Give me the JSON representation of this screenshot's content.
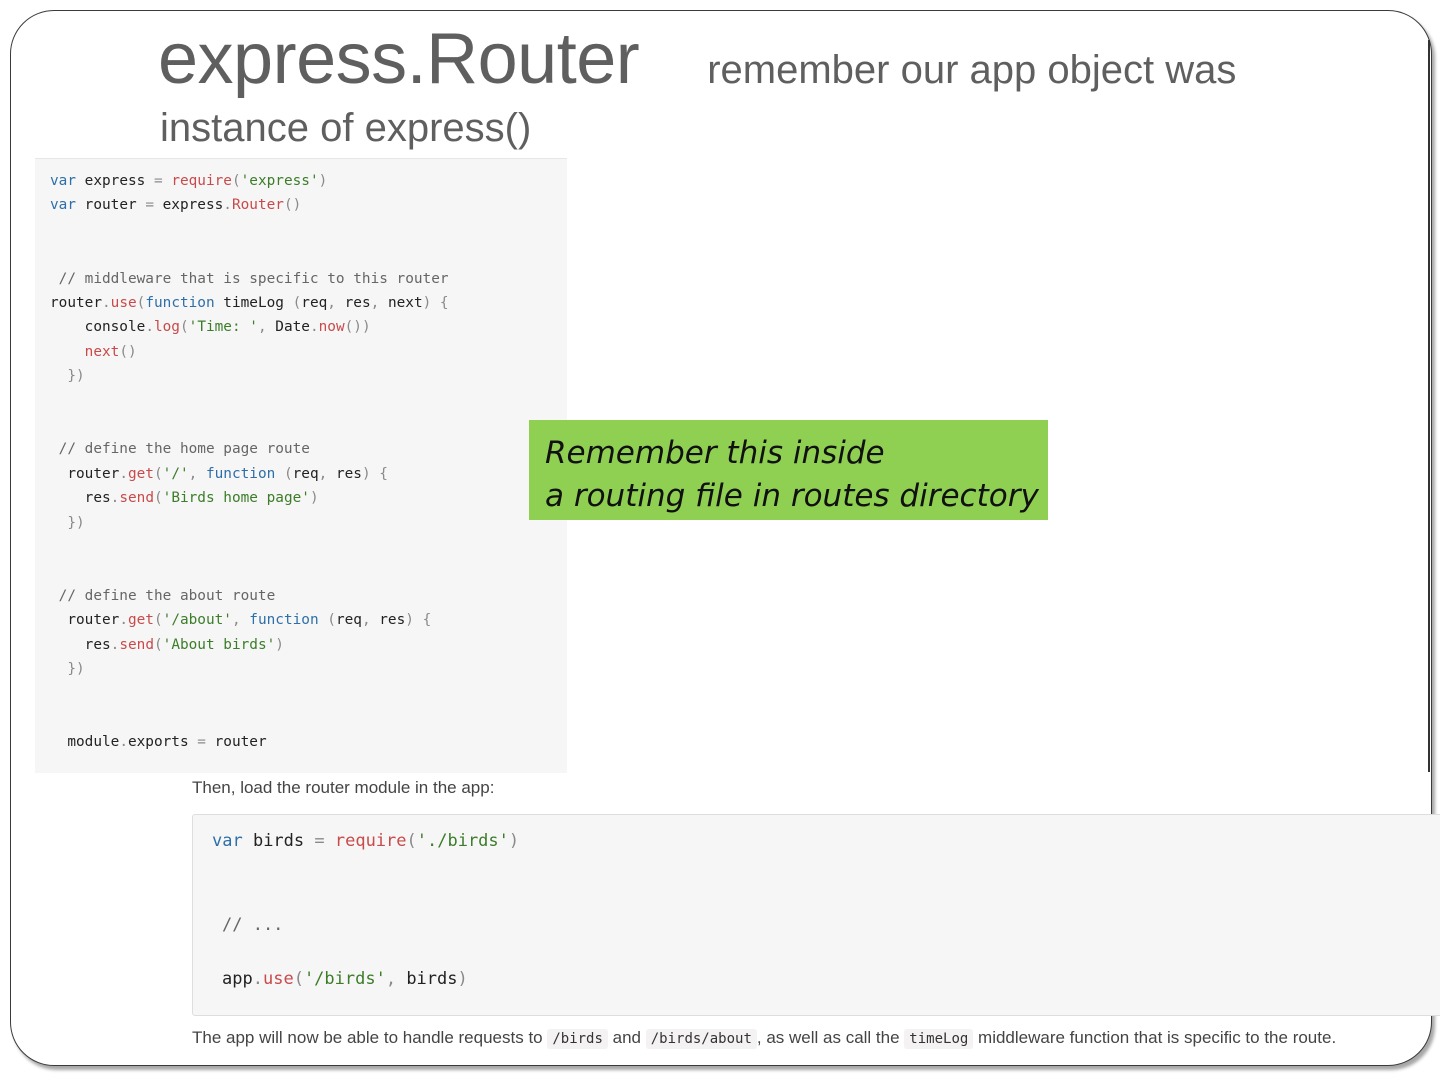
{
  "title": {
    "main": "express.Router",
    "sub": "remember our app object  was",
    "line2": "instance of express()"
  },
  "code_block_1": [
    [
      [
        "kw",
        "var"
      ],
      [
        "idn",
        " express "
      ],
      [
        "punc",
        "= "
      ],
      [
        "fn",
        "require"
      ],
      [
        "punc",
        "("
      ],
      [
        "str",
        "'express'"
      ],
      [
        "punc",
        ")"
      ]
    ],
    [
      [
        "kw",
        "var"
      ],
      [
        "idn",
        " router "
      ],
      [
        "punc",
        "= "
      ],
      [
        "idn",
        "express"
      ],
      [
        "punc",
        "."
      ],
      [
        "fn",
        "Router"
      ],
      [
        "punc",
        "()"
      ]
    ],
    [],
    [],
    [
      [
        "cmt",
        " // middleware that is specific to this router"
      ]
    ],
    [
      [
        "idn",
        "router"
      ],
      [
        "punc",
        "."
      ],
      [
        "fn",
        "use"
      ],
      [
        "punc",
        "("
      ],
      [
        "kw",
        "function"
      ],
      [
        "idn",
        " timeLog "
      ],
      [
        "punc",
        "("
      ],
      [
        "idn",
        "req"
      ],
      [
        "punc",
        ", "
      ],
      [
        "idn",
        "res"
      ],
      [
        "punc",
        ", "
      ],
      [
        "idn",
        "next"
      ],
      [
        "punc",
        ") {"
      ]
    ],
    [
      [
        "idn",
        "    console"
      ],
      [
        "punc",
        "."
      ],
      [
        "fn",
        "log"
      ],
      [
        "punc",
        "("
      ],
      [
        "str",
        "'Time: '"
      ],
      [
        "punc",
        ", "
      ],
      [
        "idn",
        "Date"
      ],
      [
        "punc",
        "."
      ],
      [
        "fn",
        "now"
      ],
      [
        "punc",
        "())"
      ]
    ],
    [
      [
        "fn",
        "    next"
      ],
      [
        "punc",
        "()"
      ]
    ],
    [
      [
        "punc",
        "  })"
      ]
    ],
    [],
    [],
    [
      [
        "cmt",
        " // define the home page route"
      ]
    ],
    [
      [
        "idn",
        "  router"
      ],
      [
        "punc",
        "."
      ],
      [
        "fn",
        "get"
      ],
      [
        "punc",
        "("
      ],
      [
        "str",
        "'/'"
      ],
      [
        "punc",
        ", "
      ],
      [
        "kw",
        "function"
      ],
      [
        "punc",
        " ("
      ],
      [
        "idn",
        "req"
      ],
      [
        "punc",
        ", "
      ],
      [
        "idn",
        "res"
      ],
      [
        "punc",
        ") {"
      ]
    ],
    [
      [
        "idn",
        "    res"
      ],
      [
        "punc",
        "."
      ],
      [
        "fn",
        "send"
      ],
      [
        "punc",
        "("
      ],
      [
        "str",
        "'Birds home page'"
      ],
      [
        "punc",
        ")"
      ]
    ],
    [
      [
        "punc",
        "  })"
      ]
    ],
    [],
    [],
    [
      [
        "cmt",
        " // define the about route"
      ]
    ],
    [
      [
        "idn",
        "  router"
      ],
      [
        "punc",
        "."
      ],
      [
        "fn",
        "get"
      ],
      [
        "punc",
        "("
      ],
      [
        "str",
        "'/about'"
      ],
      [
        "punc",
        ", "
      ],
      [
        "kw",
        "function"
      ],
      [
        "punc",
        " ("
      ],
      [
        "idn",
        "req"
      ],
      [
        "punc",
        ", "
      ],
      [
        "idn",
        "res"
      ],
      [
        "punc",
        ") {"
      ]
    ],
    [
      [
        "idn",
        "    res"
      ],
      [
        "punc",
        "."
      ],
      [
        "fn",
        "send"
      ],
      [
        "punc",
        "("
      ],
      [
        "str",
        "'About birds'"
      ],
      [
        "punc",
        ")"
      ]
    ],
    [
      [
        "punc",
        "  })"
      ]
    ],
    [],
    [],
    [
      [
        "idn",
        "  module"
      ],
      [
        "punc",
        "."
      ],
      [
        "idn",
        "exports "
      ],
      [
        "punc",
        "= "
      ],
      [
        "idn",
        "router"
      ]
    ]
  ],
  "note": {
    "line1": "Remember this inside",
    "line2": "a routing file in routes directory",
    "bg_color": "#8fd052"
  },
  "intro_text": "Then, load the router module in the app:",
  "code_block_2": [
    [
      [
        "kw",
        "var"
      ],
      [
        "idn",
        " birds "
      ],
      [
        "punc",
        "= "
      ],
      [
        "fn",
        "require"
      ],
      [
        "punc",
        "("
      ],
      [
        "str",
        "'./birds'"
      ],
      [
        "punc",
        ")"
      ]
    ],
    [
      [
        "cmt",
        "// ..."
      ]
    ],
    [
      [
        "idn",
        "app"
      ],
      [
        "punc",
        "."
      ],
      [
        "fn",
        "use"
      ],
      [
        "punc",
        "("
      ],
      [
        "str",
        "'/birds'"
      ],
      [
        "punc",
        ", "
      ],
      [
        "idn",
        "birds"
      ],
      [
        "punc",
        ")"
      ]
    ]
  ],
  "bottom_text": {
    "part1": "The app will now be able to handle requests to ",
    "code1": "/birds",
    "part2": " and ",
    "code2": "/birds/about",
    "part3": ", as well as call the ",
    "code3": "timeLog",
    "part4": " middleware function that is specific to the route."
  }
}
